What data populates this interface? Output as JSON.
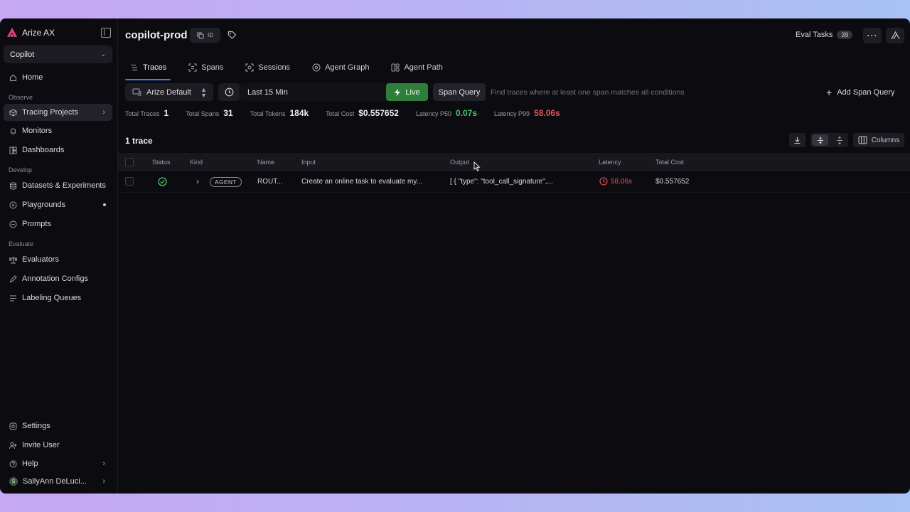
{
  "sidebar": {
    "brand": "Arize AX",
    "project_selector": "Copilot",
    "sections": {
      "observe": "Observe",
      "develop": "Develop",
      "evaluate": "Evaluate"
    },
    "items": {
      "home": "Home",
      "tracing_projects": "Tracing Projects",
      "monitors": "Monitors",
      "dashboards": "Dashboards",
      "datasets": "Datasets & Experiments",
      "playgrounds": "Playgrounds",
      "prompts": "Prompts",
      "evaluators": "Evaluators",
      "annotation_configs": "Annotation Configs",
      "labeling_queues": "Labeling Queues",
      "settings": "Settings",
      "invite_user": "Invite User",
      "help": "Help",
      "user": "SallyAnn DeLuci...",
      "user_initial": "S"
    }
  },
  "header": {
    "title": "copilot-prod",
    "id_chip": "ID",
    "eval_tasks_label": "Eval Tasks",
    "eval_tasks_count": "39"
  },
  "tabs": [
    {
      "label": "Traces",
      "icon": "list-icon",
      "active": true
    },
    {
      "label": "Spans",
      "icon": "spans-icon",
      "active": false
    },
    {
      "label": "Sessions",
      "icon": "sessions-icon",
      "active": false
    },
    {
      "label": "Agent Graph",
      "icon": "graph-icon",
      "active": false
    },
    {
      "label": "Agent Path",
      "icon": "path-icon",
      "active": false
    }
  ],
  "toolbar": {
    "space": "Arize Default",
    "time_range": "Last 15 Min",
    "live": "Live",
    "span_query": "Span Query",
    "query_placeholder": "Find traces where at least one span matches all conditions",
    "add_span_query": "Add Span Query"
  },
  "stats": {
    "total_traces_label": "Total Traces",
    "total_traces": "1",
    "total_spans_label": "Total Spans",
    "total_spans": "31",
    "total_tokens_label": "Total Tokens",
    "total_tokens": "184k",
    "total_cost_label": "Total Cost",
    "total_cost": "$0.557652",
    "latency_p50_label": "Latency P50",
    "latency_p50": "0.07s",
    "latency_p99_label": "Latency P99",
    "latency_p99": "58.06s"
  },
  "table": {
    "trace_count": "1 trace",
    "columns_button": "Columns",
    "headers": {
      "status": "Status",
      "kind": "Kind",
      "name": "Name",
      "input": "Input",
      "output": "Output",
      "latency": "Latency",
      "total_cost": "Total Cost"
    },
    "rows": [
      {
        "status": "ok",
        "kind": "AGENT",
        "name": "ROUT...",
        "input": "Create an online task to evaluate my...",
        "output": "[ { \"type\": \"tool_call_signature\",...",
        "latency": "58.06s",
        "total_cost": "$0.557652"
      }
    ]
  },
  "colors": {
    "accent": "#4b7bf0",
    "live": "#2f7d3b",
    "success": "#4cc46a",
    "error": "#e5535a",
    "brand": "#e8407a"
  }
}
